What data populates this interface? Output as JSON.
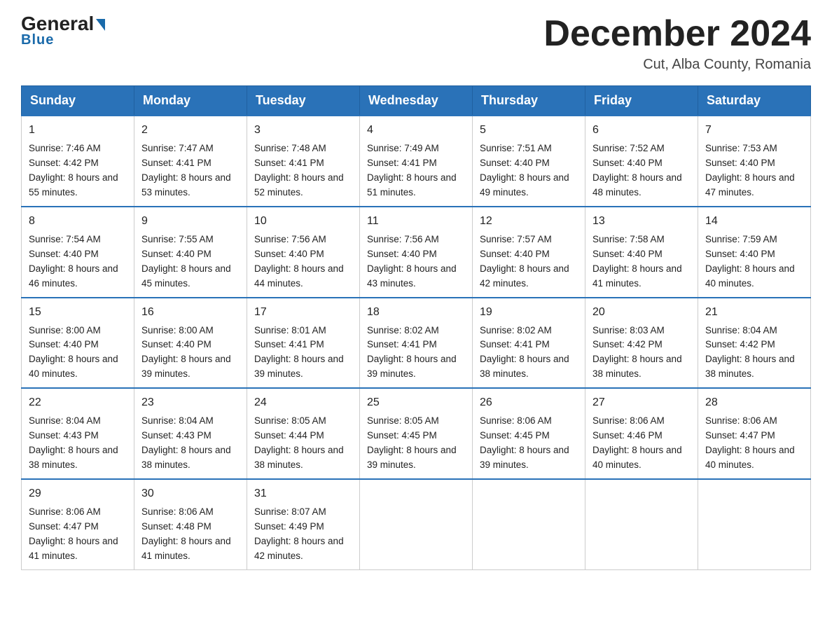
{
  "logo": {
    "general": "General",
    "triangle": "▲",
    "blue": "Blue"
  },
  "header": {
    "month": "December 2024",
    "location": "Cut, Alba County, Romania"
  },
  "days_of_week": [
    "Sunday",
    "Monday",
    "Tuesday",
    "Wednesday",
    "Thursday",
    "Friday",
    "Saturday"
  ],
  "weeks": [
    [
      {
        "day": "1",
        "sunrise": "Sunrise: 7:46 AM",
        "sunset": "Sunset: 4:42 PM",
        "daylight": "Daylight: 8 hours and 55 minutes."
      },
      {
        "day": "2",
        "sunrise": "Sunrise: 7:47 AM",
        "sunset": "Sunset: 4:41 PM",
        "daylight": "Daylight: 8 hours and 53 minutes."
      },
      {
        "day": "3",
        "sunrise": "Sunrise: 7:48 AM",
        "sunset": "Sunset: 4:41 PM",
        "daylight": "Daylight: 8 hours and 52 minutes."
      },
      {
        "day": "4",
        "sunrise": "Sunrise: 7:49 AM",
        "sunset": "Sunset: 4:41 PM",
        "daylight": "Daylight: 8 hours and 51 minutes."
      },
      {
        "day": "5",
        "sunrise": "Sunrise: 7:51 AM",
        "sunset": "Sunset: 4:40 PM",
        "daylight": "Daylight: 8 hours and 49 minutes."
      },
      {
        "day": "6",
        "sunrise": "Sunrise: 7:52 AM",
        "sunset": "Sunset: 4:40 PM",
        "daylight": "Daylight: 8 hours and 48 minutes."
      },
      {
        "day": "7",
        "sunrise": "Sunrise: 7:53 AM",
        "sunset": "Sunset: 4:40 PM",
        "daylight": "Daylight: 8 hours and 47 minutes."
      }
    ],
    [
      {
        "day": "8",
        "sunrise": "Sunrise: 7:54 AM",
        "sunset": "Sunset: 4:40 PM",
        "daylight": "Daylight: 8 hours and 46 minutes."
      },
      {
        "day": "9",
        "sunrise": "Sunrise: 7:55 AM",
        "sunset": "Sunset: 4:40 PM",
        "daylight": "Daylight: 8 hours and 45 minutes."
      },
      {
        "day": "10",
        "sunrise": "Sunrise: 7:56 AM",
        "sunset": "Sunset: 4:40 PM",
        "daylight": "Daylight: 8 hours and 44 minutes."
      },
      {
        "day": "11",
        "sunrise": "Sunrise: 7:56 AM",
        "sunset": "Sunset: 4:40 PM",
        "daylight": "Daylight: 8 hours and 43 minutes."
      },
      {
        "day": "12",
        "sunrise": "Sunrise: 7:57 AM",
        "sunset": "Sunset: 4:40 PM",
        "daylight": "Daylight: 8 hours and 42 minutes."
      },
      {
        "day": "13",
        "sunrise": "Sunrise: 7:58 AM",
        "sunset": "Sunset: 4:40 PM",
        "daylight": "Daylight: 8 hours and 41 minutes."
      },
      {
        "day": "14",
        "sunrise": "Sunrise: 7:59 AM",
        "sunset": "Sunset: 4:40 PM",
        "daylight": "Daylight: 8 hours and 40 minutes."
      }
    ],
    [
      {
        "day": "15",
        "sunrise": "Sunrise: 8:00 AM",
        "sunset": "Sunset: 4:40 PM",
        "daylight": "Daylight: 8 hours and 40 minutes."
      },
      {
        "day": "16",
        "sunrise": "Sunrise: 8:00 AM",
        "sunset": "Sunset: 4:40 PM",
        "daylight": "Daylight: 8 hours and 39 minutes."
      },
      {
        "day": "17",
        "sunrise": "Sunrise: 8:01 AM",
        "sunset": "Sunset: 4:41 PM",
        "daylight": "Daylight: 8 hours and 39 minutes."
      },
      {
        "day": "18",
        "sunrise": "Sunrise: 8:02 AM",
        "sunset": "Sunset: 4:41 PM",
        "daylight": "Daylight: 8 hours and 39 minutes."
      },
      {
        "day": "19",
        "sunrise": "Sunrise: 8:02 AM",
        "sunset": "Sunset: 4:41 PM",
        "daylight": "Daylight: 8 hours and 38 minutes."
      },
      {
        "day": "20",
        "sunrise": "Sunrise: 8:03 AM",
        "sunset": "Sunset: 4:42 PM",
        "daylight": "Daylight: 8 hours and 38 minutes."
      },
      {
        "day": "21",
        "sunrise": "Sunrise: 8:04 AM",
        "sunset": "Sunset: 4:42 PM",
        "daylight": "Daylight: 8 hours and 38 minutes."
      }
    ],
    [
      {
        "day": "22",
        "sunrise": "Sunrise: 8:04 AM",
        "sunset": "Sunset: 4:43 PM",
        "daylight": "Daylight: 8 hours and 38 minutes."
      },
      {
        "day": "23",
        "sunrise": "Sunrise: 8:04 AM",
        "sunset": "Sunset: 4:43 PM",
        "daylight": "Daylight: 8 hours and 38 minutes."
      },
      {
        "day": "24",
        "sunrise": "Sunrise: 8:05 AM",
        "sunset": "Sunset: 4:44 PM",
        "daylight": "Daylight: 8 hours and 38 minutes."
      },
      {
        "day": "25",
        "sunrise": "Sunrise: 8:05 AM",
        "sunset": "Sunset: 4:45 PM",
        "daylight": "Daylight: 8 hours and 39 minutes."
      },
      {
        "day": "26",
        "sunrise": "Sunrise: 8:06 AM",
        "sunset": "Sunset: 4:45 PM",
        "daylight": "Daylight: 8 hours and 39 minutes."
      },
      {
        "day": "27",
        "sunrise": "Sunrise: 8:06 AM",
        "sunset": "Sunset: 4:46 PM",
        "daylight": "Daylight: 8 hours and 40 minutes."
      },
      {
        "day": "28",
        "sunrise": "Sunrise: 8:06 AM",
        "sunset": "Sunset: 4:47 PM",
        "daylight": "Daylight: 8 hours and 40 minutes."
      }
    ],
    [
      {
        "day": "29",
        "sunrise": "Sunrise: 8:06 AM",
        "sunset": "Sunset: 4:47 PM",
        "daylight": "Daylight: 8 hours and 41 minutes."
      },
      {
        "day": "30",
        "sunrise": "Sunrise: 8:06 AM",
        "sunset": "Sunset: 4:48 PM",
        "daylight": "Daylight: 8 hours and 41 minutes."
      },
      {
        "day": "31",
        "sunrise": "Sunrise: 8:07 AM",
        "sunset": "Sunset: 4:49 PM",
        "daylight": "Daylight: 8 hours and 42 minutes."
      },
      null,
      null,
      null,
      null
    ]
  ]
}
